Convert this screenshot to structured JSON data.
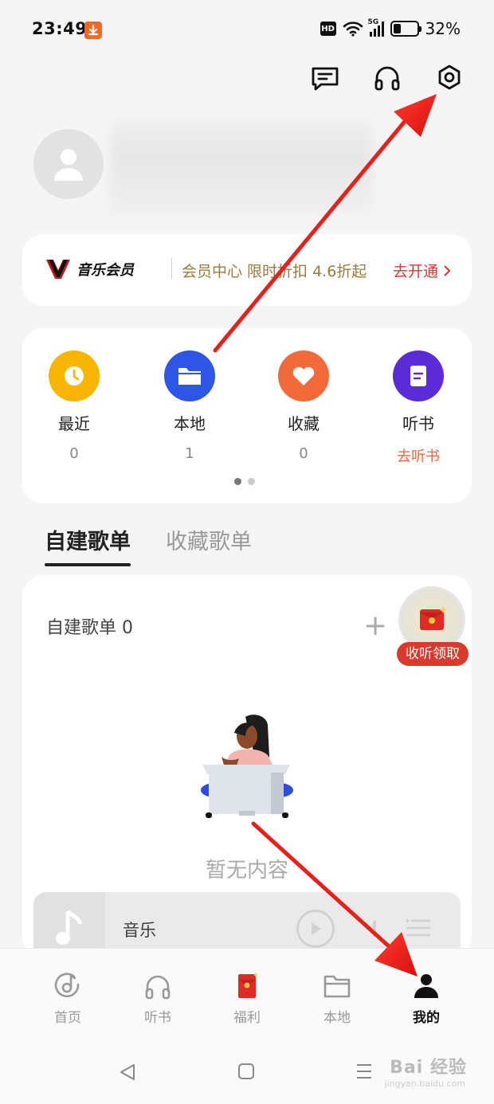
{
  "status_bar": {
    "time": "23:49",
    "hd": "HD",
    "network": "5G",
    "battery_percent": 32,
    "battery_text": "32%"
  },
  "header_icons": [
    "message-icon",
    "headphones-icon",
    "settings-icon"
  ],
  "vip": {
    "logo_text": "音乐会员",
    "description": "会员中心 限时折扣 4.6折起",
    "cta": "去开通"
  },
  "quick_access": [
    {
      "label": "最近",
      "count": "0",
      "icon": "clock-icon",
      "color": "#f7b500"
    },
    {
      "label": "本地",
      "count": "1",
      "icon": "folder-icon",
      "color": "#2e55e6"
    },
    {
      "label": "收藏",
      "count": "0",
      "icon": "heart-icon",
      "color": "#f26a3a"
    },
    {
      "label": "听书",
      "count": "去听书",
      "icon": "book-icon",
      "color": "#5a2bd6"
    }
  ],
  "tabs": [
    "自建歌单",
    "收藏歌单"
  ],
  "playlist": {
    "title": "自建歌单 0",
    "add_label": "+",
    "reward_label": "收听领取",
    "empty_text": "暂无内容"
  },
  "mini_player": {
    "title": "音乐"
  },
  "bottom_nav": [
    {
      "label": "首页",
      "icon": "home-disc-icon"
    },
    {
      "label": "听书",
      "icon": "headphones-icon"
    },
    {
      "label": "福利",
      "icon": "red-envelope-icon"
    },
    {
      "label": "本地",
      "icon": "folder-icon"
    },
    {
      "label": "我的",
      "icon": "user-icon",
      "active": true
    }
  ],
  "watermark": {
    "text": "Bai 经验",
    "sub": "jingyan.baidu.com"
  },
  "colors": {
    "accent_red": "#d73a2d",
    "vip_gold": "#9a7a3d",
    "arrow_red": "#e8201a"
  }
}
